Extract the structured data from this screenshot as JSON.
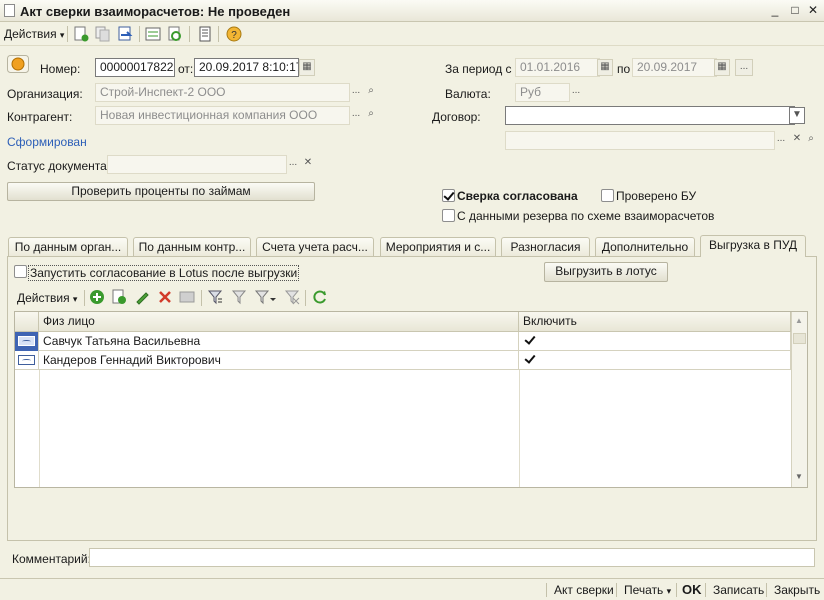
{
  "window": {
    "title": "Акт сверки взаиморасчетов: Не проведен",
    "minimize": "_",
    "maximize": "□",
    "close": "✕"
  },
  "toolbar": {
    "actions_label": "Действия",
    "dropdown_arrow": "▾"
  },
  "form": {
    "number_label": "Номер:",
    "number_value": "00000017822",
    "date_label": "от:",
    "date_value": "20.09.2017  8:10:17",
    "period_label": "За период с",
    "period_from": "01.01.2016",
    "period_to_label": "по",
    "period_to": "20.09.2017",
    "org_label": "Организация:",
    "org_value": "Строй-Инспект-2 ООО",
    "currency_label": "Валюта:",
    "currency_value": "Руб",
    "counterparty_label": "Контрагент:",
    "counterparty_value": "Новая инвестиционная компания ООО",
    "contract_label": "Договор:",
    "contract_value": "",
    "formed_link": "Сформирован",
    "status_label": "Статус документа:",
    "status_value": "",
    "check_loans_button": "Проверить проценты по займам",
    "agreed_label": "Сверка согласована",
    "agreed_checked": true,
    "checked_bu_label": "Проверено БУ",
    "checked_bu_checked": false,
    "reserve_label": "С данными резерва по схеме взаиморасчетов",
    "reserve_checked": false,
    "ellipsis": "...",
    "clear": "✕",
    "search": "🔍"
  },
  "tabs": [
    {
      "label": "По данным орган..."
    },
    {
      "label": "По данным контр..."
    },
    {
      "label": "Счета учета расч..."
    },
    {
      "label": "Мероприятия и с..."
    },
    {
      "label": "Разногласия"
    },
    {
      "label": "Дополнительно"
    },
    {
      "label": "Выгрузка в ПУД"
    }
  ],
  "pud": {
    "lotus_checkbox_label": "Запустить согласование в Lotus после выгрузки",
    "lotus_checked": false,
    "upload_button": "Выгрузить в лотус",
    "actions_label": "Действия"
  },
  "grid": {
    "columns": [
      "Физ лицо",
      "Включить"
    ],
    "rows": [
      {
        "name": "Савчук Татьяна Васильевна",
        "include": true
      },
      {
        "name": "Кандеров Геннадий Викторович",
        "include": true
      }
    ]
  },
  "comment": {
    "label": "Комментарий:",
    "value": ""
  },
  "statusbar": {
    "act": "Акт сверки",
    "print": "Печать",
    "print_arrow": "▾",
    "ok": "OK",
    "save": "Записать",
    "close": "Закрыть"
  },
  "colors": {
    "accent_blue": "#2d5fb8",
    "add_green": "#3a9a2d",
    "delete_red": "#d23a2a"
  }
}
